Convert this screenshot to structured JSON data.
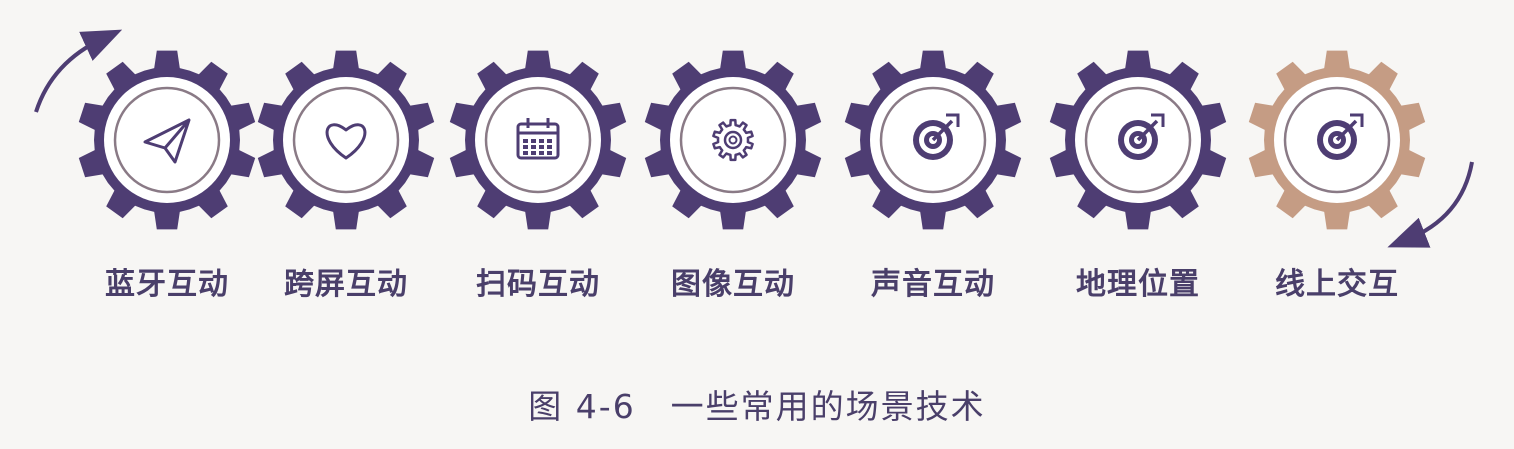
{
  "colors": {
    "gear_primary": "#4e3d73",
    "gear_accent": "#c59c84",
    "ring": "#8a7a86",
    "text": "#4a3f6a"
  },
  "gears": [
    {
      "label": "蓝牙互动",
      "icon": "paper-plane-icon",
      "color": "#4e3d73"
    },
    {
      "label": "跨屏互动",
      "icon": "heart-icon",
      "color": "#4e3d73"
    },
    {
      "label": "扫码互动",
      "icon": "calendar-icon",
      "color": "#4e3d73"
    },
    {
      "label": "图像互动",
      "icon": "gear-icon",
      "color": "#4e3d73"
    },
    {
      "label": "声音互动",
      "icon": "target-icon",
      "color": "#4e3d73"
    },
    {
      "label": "地理位置",
      "icon": "target-icon",
      "color": "#4e3d73"
    },
    {
      "label": "线上交互",
      "icon": "target-icon",
      "color": "#c59c84"
    }
  ],
  "caption": "图 4-6　一些常用的场景技术"
}
